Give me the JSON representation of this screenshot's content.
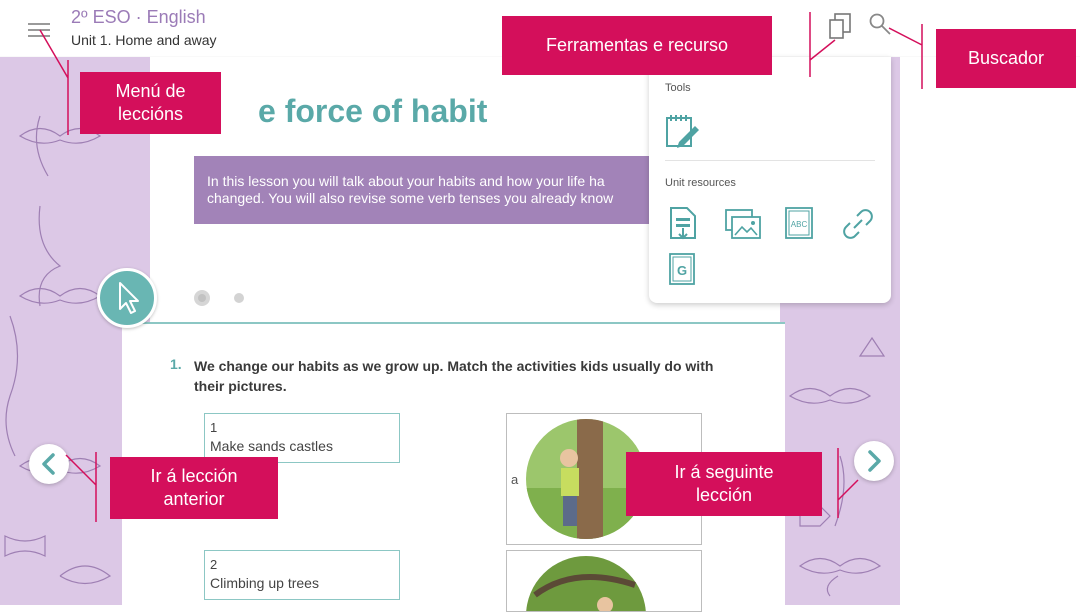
{
  "header": {
    "course_title": "2º ESO · English",
    "unit_title": "Unit 1. Home and away",
    "icons": [
      "menu-icon",
      "tools-icon",
      "search-icon"
    ]
  },
  "lesson": {
    "title": "e force of habit",
    "intro": "In this lesson you will talk about your habits and how your life ha\nchanged. You will also revise some verb tenses you already know"
  },
  "exercise": {
    "number": "1.",
    "instruction": "We change our habits as we grow up. Match the activities kids usually do with their pictures.",
    "items": [
      {
        "number": "1",
        "label": "Make sands castles"
      },
      {
        "number": "2",
        "label": "Climbing up trees"
      }
    ],
    "pictures": [
      {
        "letter": "a"
      }
    ]
  },
  "tools_panel": {
    "tools_heading": "Tools",
    "resources_heading": "Unit resources",
    "tools": [
      "notebook-icon"
    ],
    "resources": [
      "document-download-icon",
      "gallery-icon",
      "abc-glossary-icon",
      "link-icon",
      "grammar-icon"
    ],
    "grammar_letter": "G",
    "abc_text": "ABC"
  },
  "callouts": {
    "tools": "Ferramentas e recurso",
    "search": "Buscador",
    "lessons_menu": "Menú de\nleccións",
    "prev_lesson": "Ir á lección\nanterior",
    "next_lesson": "Ir á seguinte\nlección"
  },
  "colors": {
    "accent_teal": "#5aa9a8",
    "intro_purple": "#a283b8",
    "callout_pink": "#d40f5b",
    "pattern_lilac": "#dcc8e6"
  }
}
